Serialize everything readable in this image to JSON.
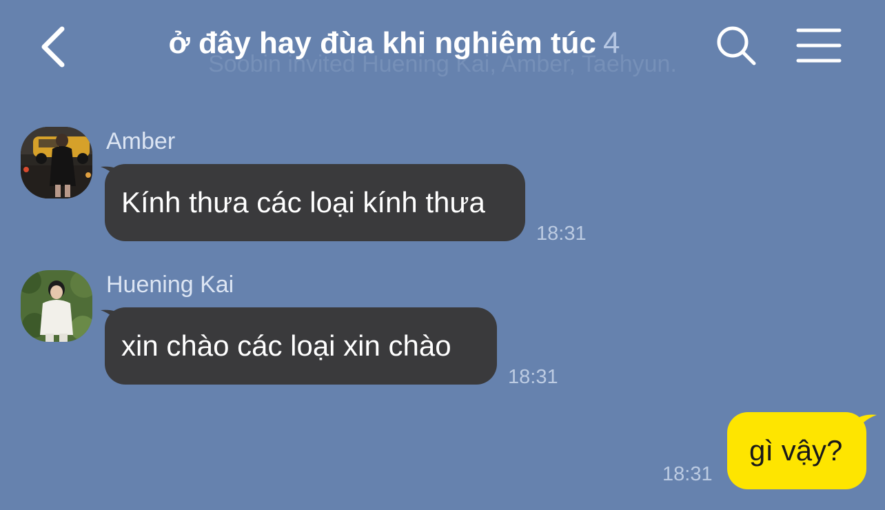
{
  "header": {
    "title": "ở đây hay đùa khi nghiêm túc",
    "member_count": "4",
    "invite_notice": "Soobin invited Huening Kai, Amber, Taehyun."
  },
  "icons": {
    "back": "chevron-left-icon",
    "search": "search-icon",
    "menu": "hamburger-menu-icon"
  },
  "colors": {
    "background": "#6682ae",
    "incoming_bubble": "#3a3a3c",
    "outgoing_bubble": "#fee500"
  },
  "messages": [
    {
      "sender": "Amber",
      "text": "Kính thưa các loại kính thưa",
      "time": "18:31"
    },
    {
      "sender": "Huening Kai",
      "text": "xin chào các loại xin chào",
      "time": "18:31"
    },
    {
      "sender": "me",
      "text": "gì vậy?",
      "time": "18:31"
    }
  ]
}
